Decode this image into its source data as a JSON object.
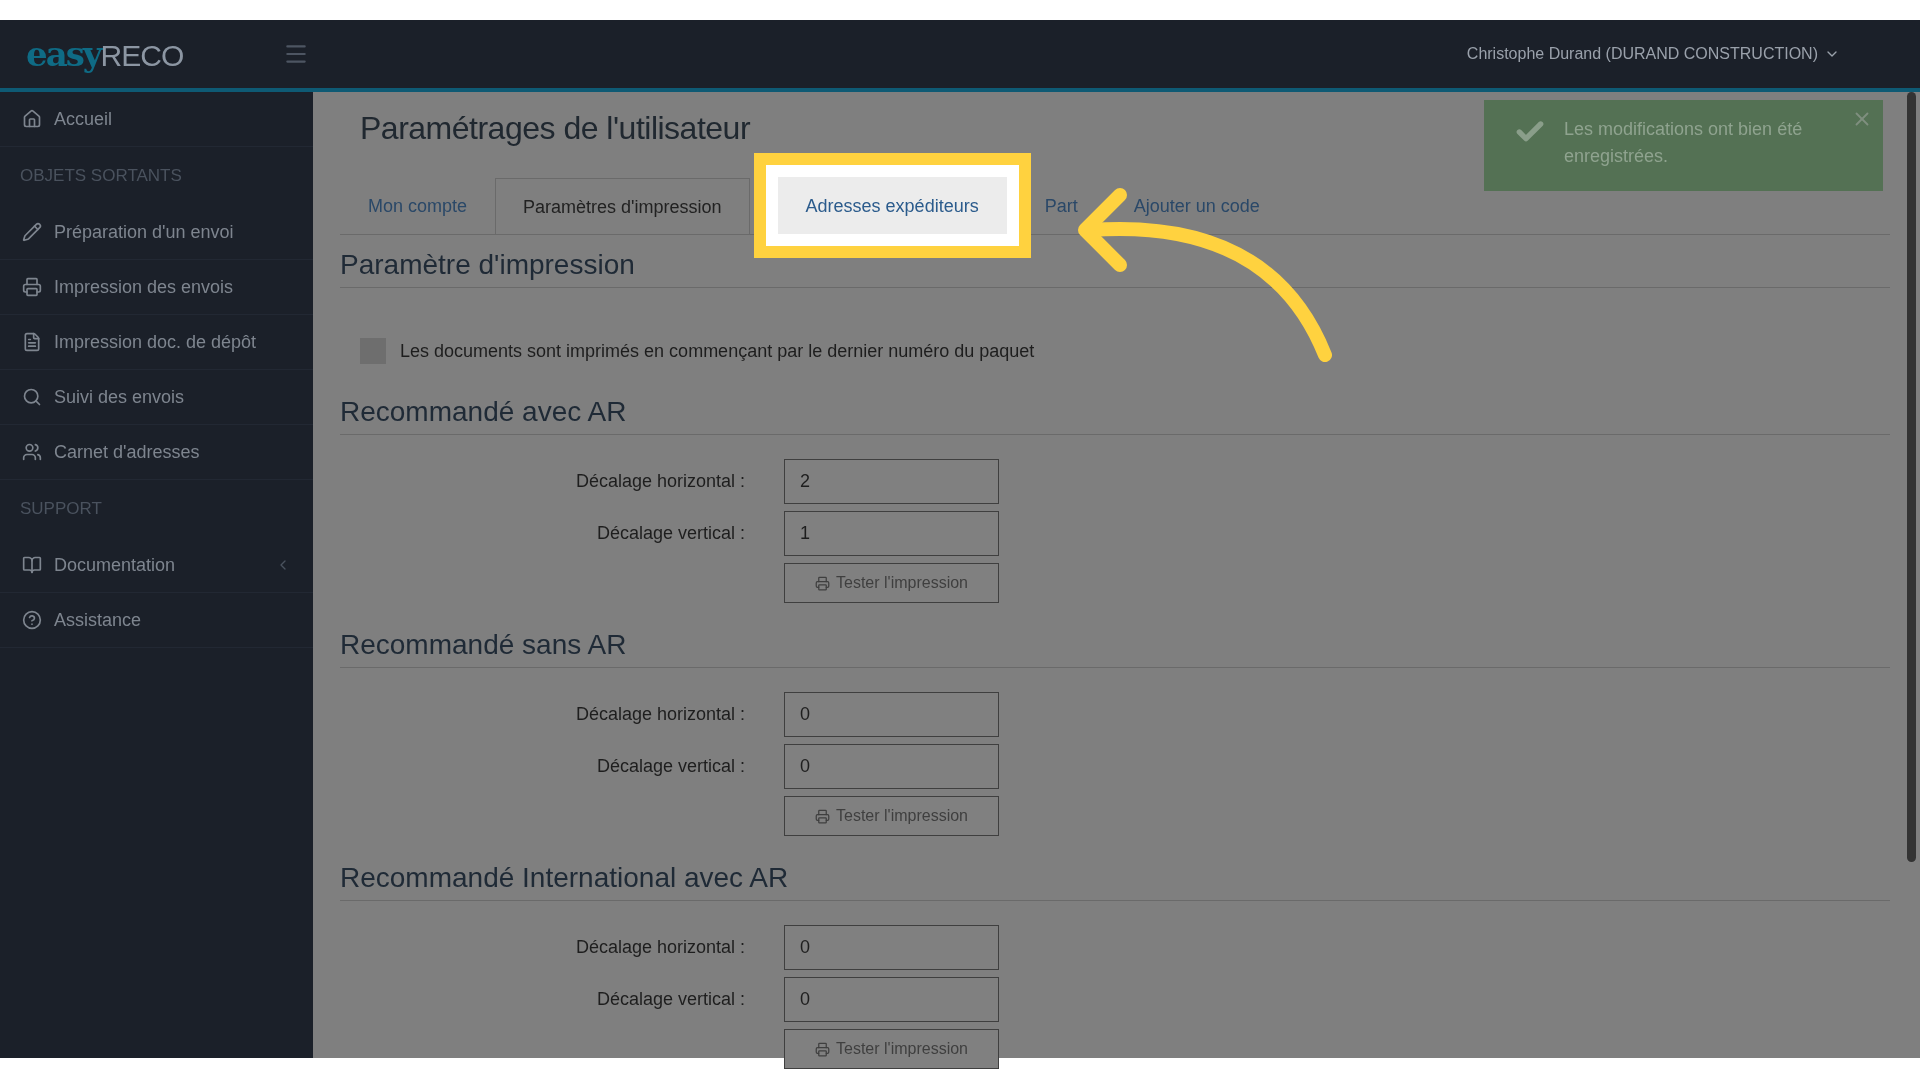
{
  "header": {
    "logo_bold": "easy",
    "logo_light": "RECO",
    "user": "Christophe Durand (DURAND CONSTRUCTION)"
  },
  "toast": {
    "message": "Les modifications ont bien été enregistrées."
  },
  "sidebar": {
    "items": [
      {
        "kind": "link",
        "label": "Accueil"
      },
      {
        "kind": "section",
        "label": "OBJETS SORTANTS"
      },
      {
        "kind": "link",
        "label": "Préparation d'un envoi"
      },
      {
        "kind": "link",
        "label": "Impression des envois"
      },
      {
        "kind": "link",
        "label": "Impression doc. de dépôt"
      },
      {
        "kind": "link",
        "label": "Suivi des envois"
      },
      {
        "kind": "link",
        "label": "Carnet d'adresses"
      },
      {
        "kind": "section",
        "label": "SUPPORT"
      },
      {
        "kind": "link",
        "label": "Documentation",
        "expandable": true
      },
      {
        "kind": "link",
        "label": "Assistance"
      }
    ]
  },
  "page": {
    "title": "Paramétrages de l'utilisateur"
  },
  "tabs": [
    {
      "label": "Mon compte",
      "selected": false,
      "highlighted": false
    },
    {
      "label": "Paramètres d'impression",
      "selected": true,
      "highlighted": false
    },
    {
      "label": "Adresses expéditeurs",
      "selected": false,
      "highlighted": true
    },
    {
      "label": "Part",
      "selected": false,
      "highlighted": false
    },
    {
      "label": "Ajouter un code",
      "selected": false,
      "highlighted": false
    }
  ],
  "print_settings": {
    "heading": "Paramètre d'impression",
    "checkbox": {
      "label": "Les documents sont imprimés en commençant par le dernier numéro du paquet",
      "checked": false
    }
  },
  "offset_sections": [
    {
      "heading": "Recommandé avec AR",
      "fields": [
        {
          "label": "Décalage horizontal :",
          "value": "2"
        },
        {
          "label": "Décalage vertical :",
          "value": "1"
        }
      ],
      "button": "Tester l'impression"
    },
    {
      "heading": "Recommandé sans AR",
      "fields": [
        {
          "label": "Décalage horizontal :",
          "value": "0"
        },
        {
          "label": "Décalage vertical :",
          "value": "0"
        }
      ],
      "button": "Tester l'impression"
    },
    {
      "heading": "Recommandé International avec AR",
      "fields": [
        {
          "label": "Décalage horizontal :",
          "value": "0"
        },
        {
          "label": "Décalage vertical :",
          "value": "0"
        }
      ],
      "button": "Tester l'impression"
    }
  ]
}
